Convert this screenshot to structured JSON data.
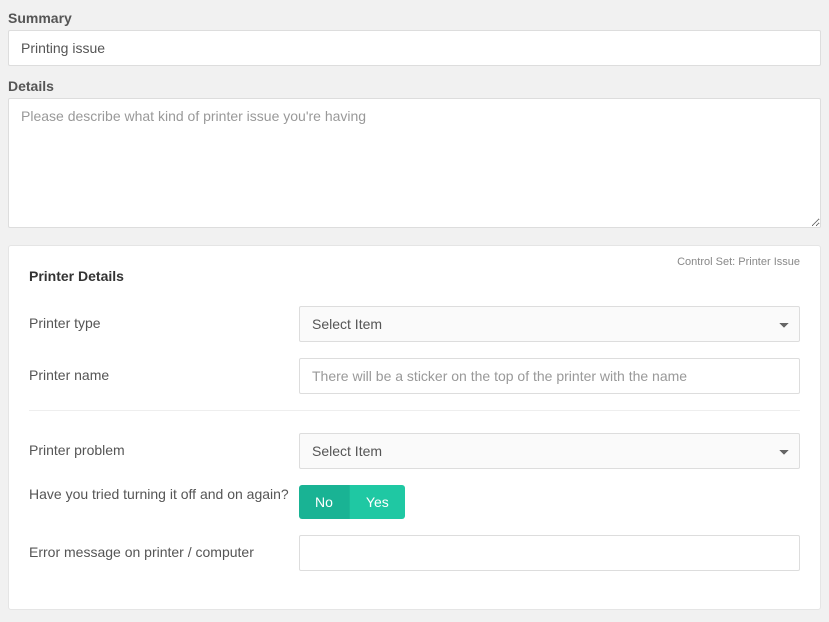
{
  "summary": {
    "label": "Summary",
    "value": "Printing issue"
  },
  "details": {
    "label": "Details",
    "placeholder": "Please describe what kind of printer issue you're having"
  },
  "panel": {
    "control_set": "Control Set: Printer Issue",
    "title": "Printer Details",
    "printer_type": {
      "label": "Printer type",
      "selected": "Select Item"
    },
    "printer_name": {
      "label": "Printer name",
      "placeholder": "There will be a sticker on the top of the printer with the name"
    },
    "printer_problem": {
      "label": "Printer problem",
      "selected": "Select Item"
    },
    "tried_off_on": {
      "label": "Have you tried turning it off and on again?",
      "no": "No",
      "yes": "Yes"
    },
    "error_message": {
      "label": "Error message on printer / computer",
      "value": ""
    }
  }
}
